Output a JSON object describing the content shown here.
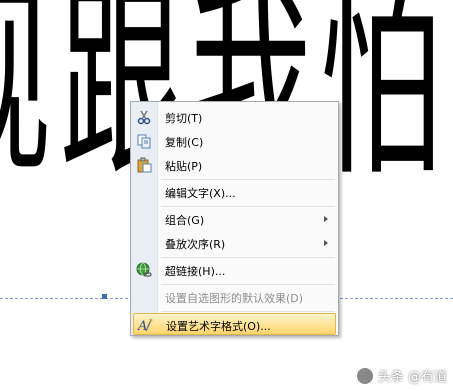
{
  "document": {
    "wordart_text": "现跟我怕"
  },
  "context_menu": {
    "items": [
      {
        "label": "剪切(T)",
        "icon": "scissors-icon"
      },
      {
        "label": "复制(C)",
        "icon": "copy-icon"
      },
      {
        "label": "粘贴(P)",
        "icon": "paste-icon"
      },
      {
        "label": "编辑文字(X)...",
        "icon": ""
      },
      {
        "label": "组合(G)",
        "icon": "",
        "submenu": true
      },
      {
        "label": "叠放次序(R)",
        "icon": "",
        "submenu": true
      },
      {
        "label": "超链接(H)...",
        "icon": "hyperlink-globe-icon"
      },
      {
        "label": "设置自选图形的默认效果(D)",
        "icon": "",
        "disabled": true
      },
      {
        "label": "设置艺术字格式(O)...",
        "icon": "format-wordart-icon",
        "highlighted": true
      }
    ]
  },
  "watermark": {
    "text": "头条 @有道"
  },
  "colors": {
    "highlight": "#ffd56b",
    "gutter": "#e9eef5",
    "selection_line": "#8aa0c8"
  }
}
